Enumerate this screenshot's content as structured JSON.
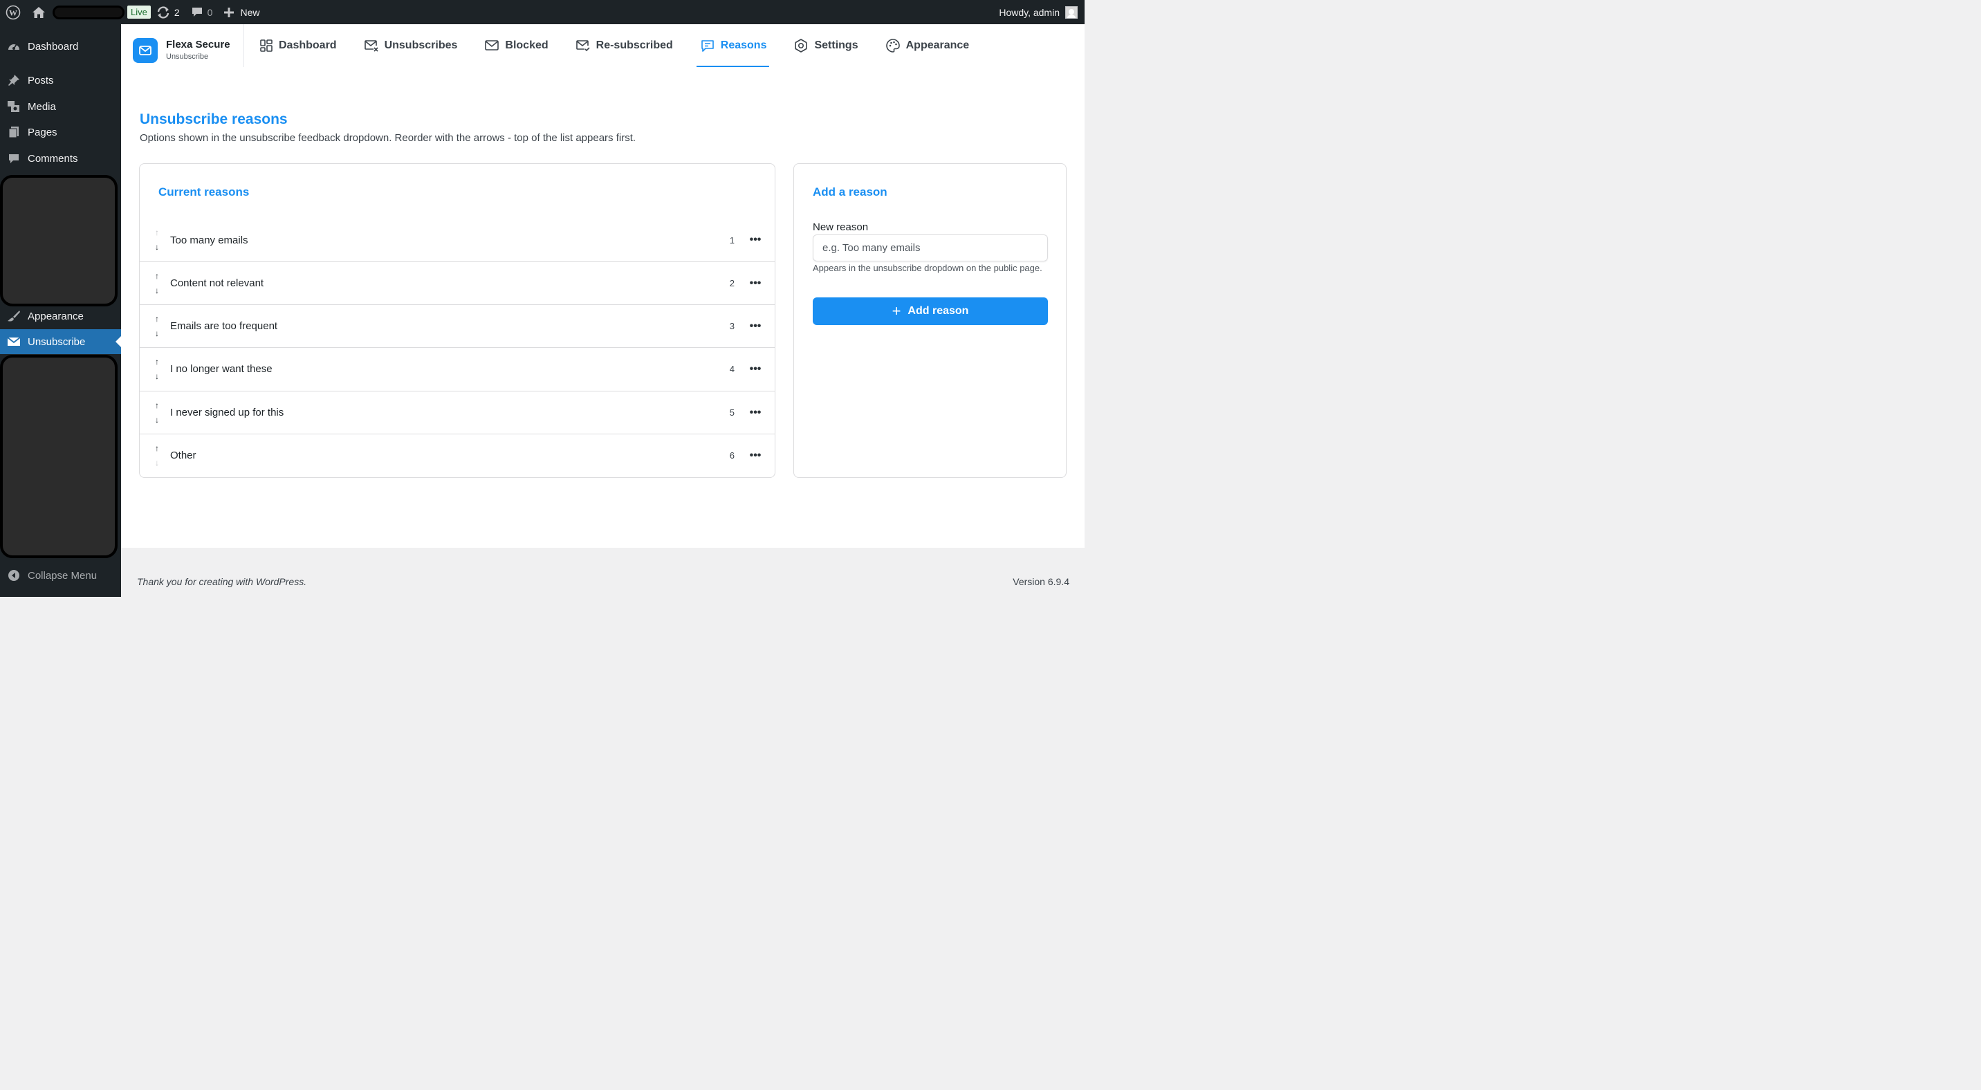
{
  "adminbar": {
    "live_label": "Live",
    "updates_count": "2",
    "comments_count": "0",
    "new_label": "New",
    "howdy": "Howdy, admin"
  },
  "sidebar": {
    "items": [
      {
        "label": "Dashboard"
      },
      {
        "label": "Posts"
      },
      {
        "label": "Media"
      },
      {
        "label": "Pages"
      },
      {
        "label": "Comments"
      },
      {
        "label": "Appearance"
      },
      {
        "label": "Unsubscribe"
      }
    ],
    "collapse_label": "Collapse Menu"
  },
  "brand": {
    "name": "Flexa Secure",
    "subtitle": "Unsubscribe"
  },
  "tabs": [
    {
      "label": "Dashboard"
    },
    {
      "label": "Unsubscribes"
    },
    {
      "label": "Blocked"
    },
    {
      "label": "Re-subscribed"
    },
    {
      "label": "Reasons"
    },
    {
      "label": "Settings"
    },
    {
      "label": "Appearance"
    }
  ],
  "page": {
    "title": "Unsubscribe reasons",
    "description": "Options shown in the unsubscribe feedback dropdown. Reorder with the arrows - top of the list appears first."
  },
  "reasons_card": {
    "title": "Current reasons",
    "rows": [
      {
        "label": "Too many emails",
        "order": "1"
      },
      {
        "label": "Content not relevant",
        "order": "2"
      },
      {
        "label": "Emails are too frequent",
        "order": "3"
      },
      {
        "label": "I no longer want these",
        "order": "4"
      },
      {
        "label": "I never signed up for this",
        "order": "5"
      },
      {
        "label": "Other",
        "order": "6"
      }
    ],
    "arrow_up": "↑",
    "arrow_down": "↓",
    "menu_glyph": "•••"
  },
  "add_card": {
    "title": "Add a reason",
    "field_label": "New reason",
    "placeholder": "e.g. Too many emails",
    "help": "Appears in the unsubscribe dropdown on the public page.",
    "button_label": "Add reason",
    "button_icon": "+"
  },
  "footer": {
    "thanks": "Thank you for creating with WordPress.",
    "version": "Version 6.9.4"
  },
  "colors": {
    "accent": "#1a8ff2",
    "admin_dark": "#1d2327",
    "wp_active": "#2271b1"
  }
}
